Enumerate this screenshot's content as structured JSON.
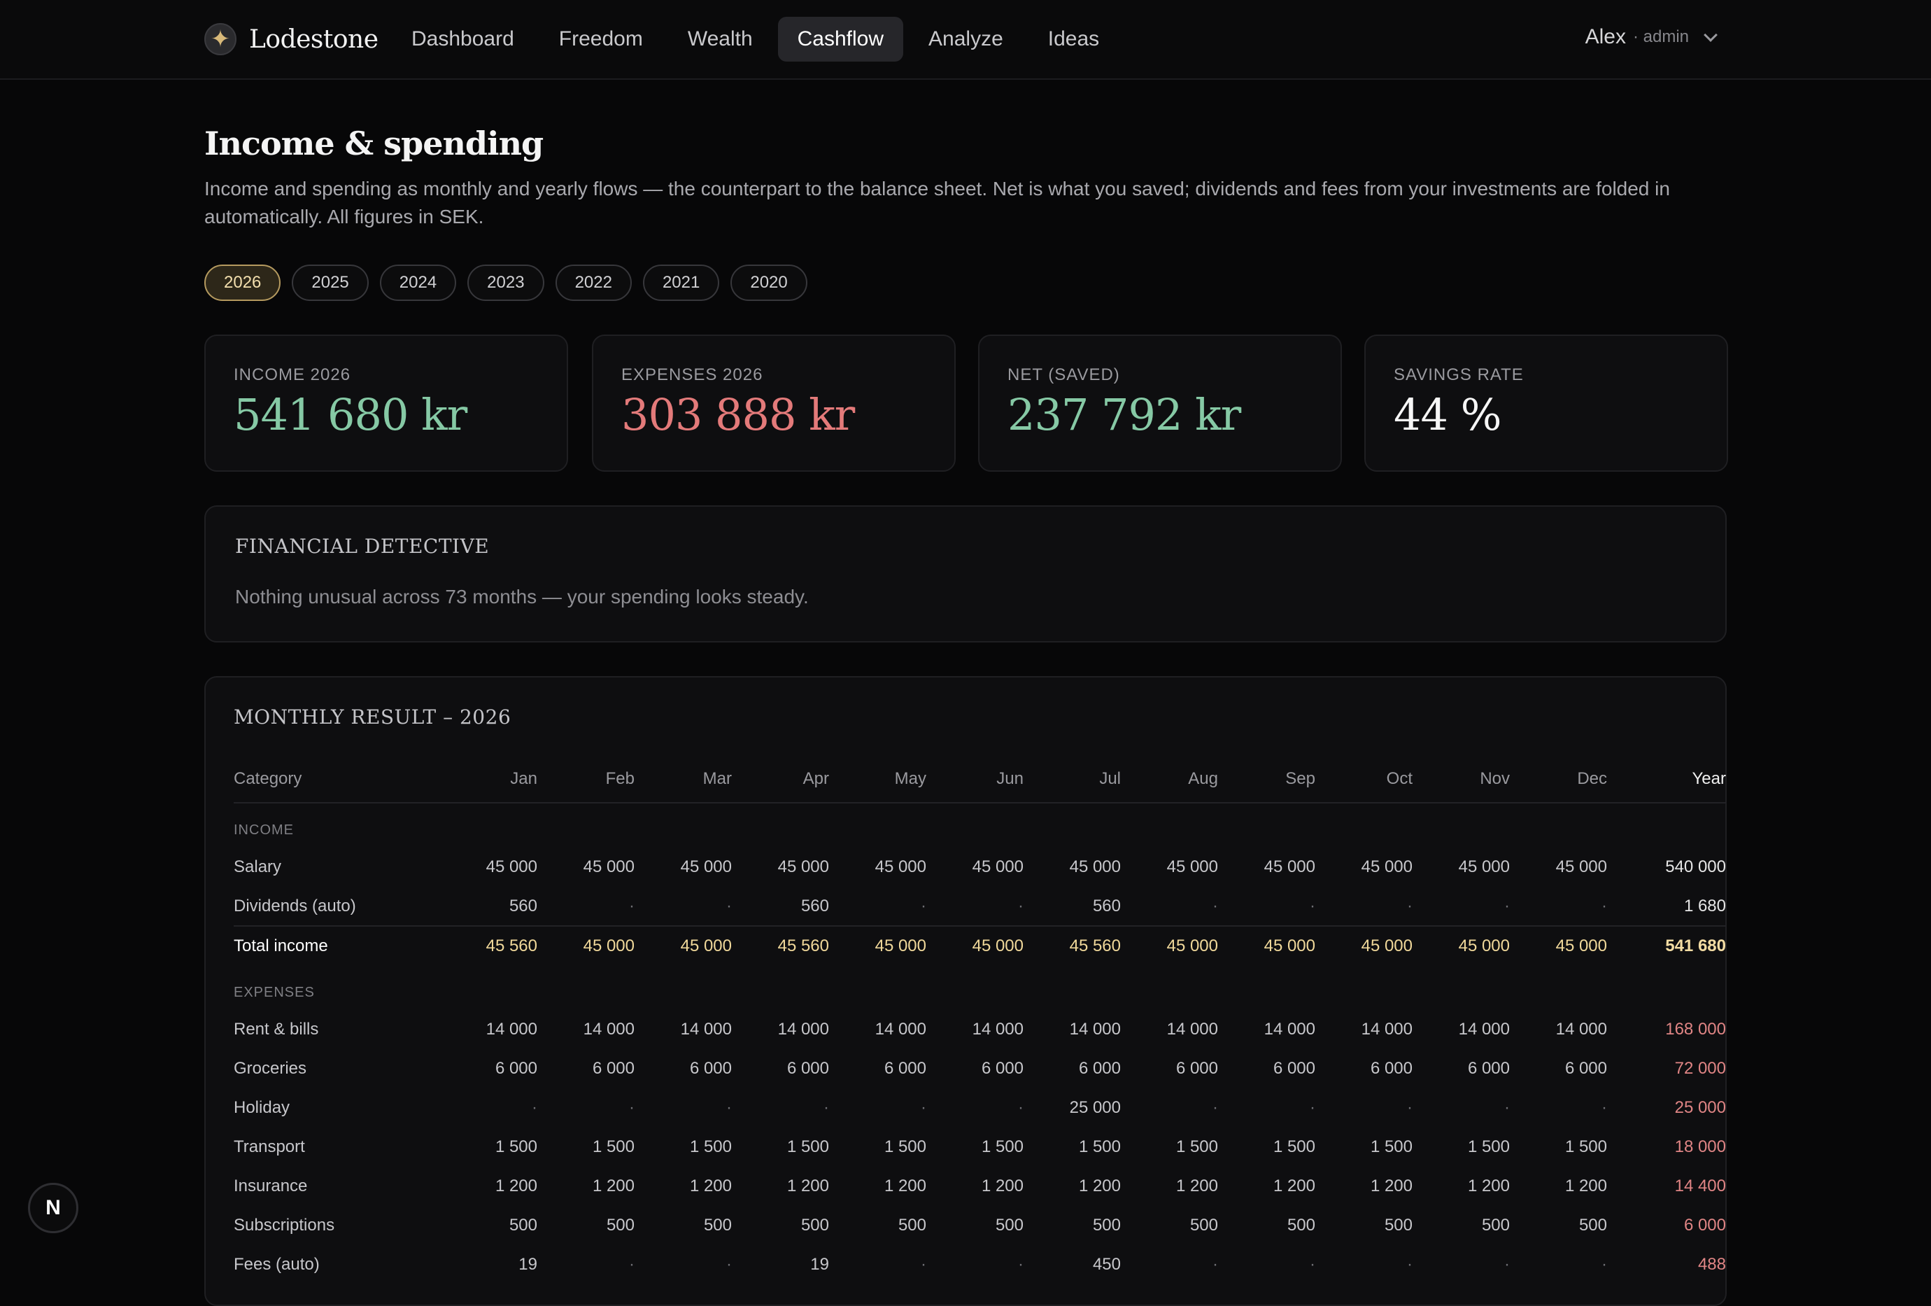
{
  "brand": {
    "name": "Lodestone",
    "mark": "✦"
  },
  "nav": [
    {
      "label": "Dashboard"
    },
    {
      "label": "Freedom"
    },
    {
      "label": "Wealth"
    },
    {
      "label": "Cashflow",
      "active": true
    },
    {
      "label": "Analyze"
    },
    {
      "label": "Ideas"
    }
  ],
  "user": {
    "name": "Alex",
    "role": "· admin"
  },
  "page": {
    "title": "Income & spending",
    "description": "Income and spending as monthly and yearly flows — the counterpart to the balance sheet. Net is what you saved; dividends and fees from your investments are folded in automatically. All figures in SEK."
  },
  "years": [
    "2026",
    "2025",
    "2024",
    "2023",
    "2022",
    "2021",
    "2020"
  ],
  "active_year": "2026",
  "cards": [
    {
      "label": "INCOME 2026",
      "value": "541 680 kr",
      "tone": "green"
    },
    {
      "label": "EXPENSES 2026",
      "value": "303 888 kr",
      "tone": "red"
    },
    {
      "label": "NET (SAVED)",
      "value": "237 792 kr",
      "tone": "green"
    },
    {
      "label": "SAVINGS RATE",
      "value": "44 %",
      "tone": "white"
    }
  ],
  "detective": {
    "title": "FINANCIAL DETECTIVE",
    "message": "Nothing unusual across 73 months — your spending looks steady."
  },
  "monthly": {
    "title": "MONTHLY RESULT – 2026",
    "columns": [
      "Category",
      "Jan",
      "Feb",
      "Mar",
      "Apr",
      "May",
      "Jun",
      "Jul",
      "Aug",
      "Sep",
      "Oct",
      "Nov",
      "Dec",
      "Year"
    ],
    "rows": [
      {
        "type": "section",
        "label": "INCOME"
      },
      {
        "type": "income",
        "label": "Salary",
        "values": [
          "45 000",
          "45 000",
          "45 000",
          "45 000",
          "45 000",
          "45 000",
          "45 000",
          "45 000",
          "45 000",
          "45 000",
          "45 000",
          "45 000"
        ],
        "year": "540 000"
      },
      {
        "type": "income",
        "label": "Dividends (auto)",
        "values": [
          "560",
          "·",
          "·",
          "560",
          "·",
          "·",
          "560",
          "·",
          "·",
          "·",
          "·",
          "·"
        ],
        "year": "1 680"
      },
      {
        "type": "total",
        "label": "Total income",
        "values": [
          "45 560",
          "45 000",
          "45 000",
          "45 560",
          "45 000",
          "45 000",
          "45 560",
          "45 000",
          "45 000",
          "45 000",
          "45 000",
          "45 000"
        ],
        "year": "541 680"
      },
      {
        "type": "section",
        "label": "EXPENSES"
      },
      {
        "type": "expense",
        "label": "Rent & bills",
        "values": [
          "14 000",
          "14 000",
          "14 000",
          "14 000",
          "14 000",
          "14 000",
          "14 000",
          "14 000",
          "14 000",
          "14 000",
          "14 000",
          "14 000"
        ],
        "year": "168 000"
      },
      {
        "type": "expense",
        "label": "Groceries",
        "values": [
          "6 000",
          "6 000",
          "6 000",
          "6 000",
          "6 000",
          "6 000",
          "6 000",
          "6 000",
          "6 000",
          "6 000",
          "6 000",
          "6 000"
        ],
        "year": "72 000"
      },
      {
        "type": "expense",
        "label": "Holiday",
        "values": [
          "·",
          "·",
          "·",
          "·",
          "·",
          "·",
          "25 000",
          "·",
          "·",
          "·",
          "·",
          "·"
        ],
        "year": "25 000"
      },
      {
        "type": "expense",
        "label": "Transport",
        "values": [
          "1 500",
          "1 500",
          "1 500",
          "1 500",
          "1 500",
          "1 500",
          "1 500",
          "1 500",
          "1 500",
          "1 500",
          "1 500",
          "1 500"
        ],
        "year": "18 000"
      },
      {
        "type": "expense",
        "label": "Insurance",
        "values": [
          "1 200",
          "1 200",
          "1 200",
          "1 200",
          "1 200",
          "1 200",
          "1 200",
          "1 200",
          "1 200",
          "1 200",
          "1 200",
          "1 200"
        ],
        "year": "14 400"
      },
      {
        "type": "expense",
        "label": "Subscriptions",
        "values": [
          "500",
          "500",
          "500",
          "500",
          "500",
          "500",
          "500",
          "500",
          "500",
          "500",
          "500",
          "500"
        ],
        "year": "6 000"
      },
      {
        "type": "expense",
        "label": "Fees (auto)",
        "values": [
          "19",
          "·",
          "·",
          "19",
          "·",
          "·",
          "450",
          "·",
          "·",
          "·",
          "·",
          "·"
        ],
        "year": "488"
      }
    ]
  },
  "badge": {
    "letter": "N"
  }
}
